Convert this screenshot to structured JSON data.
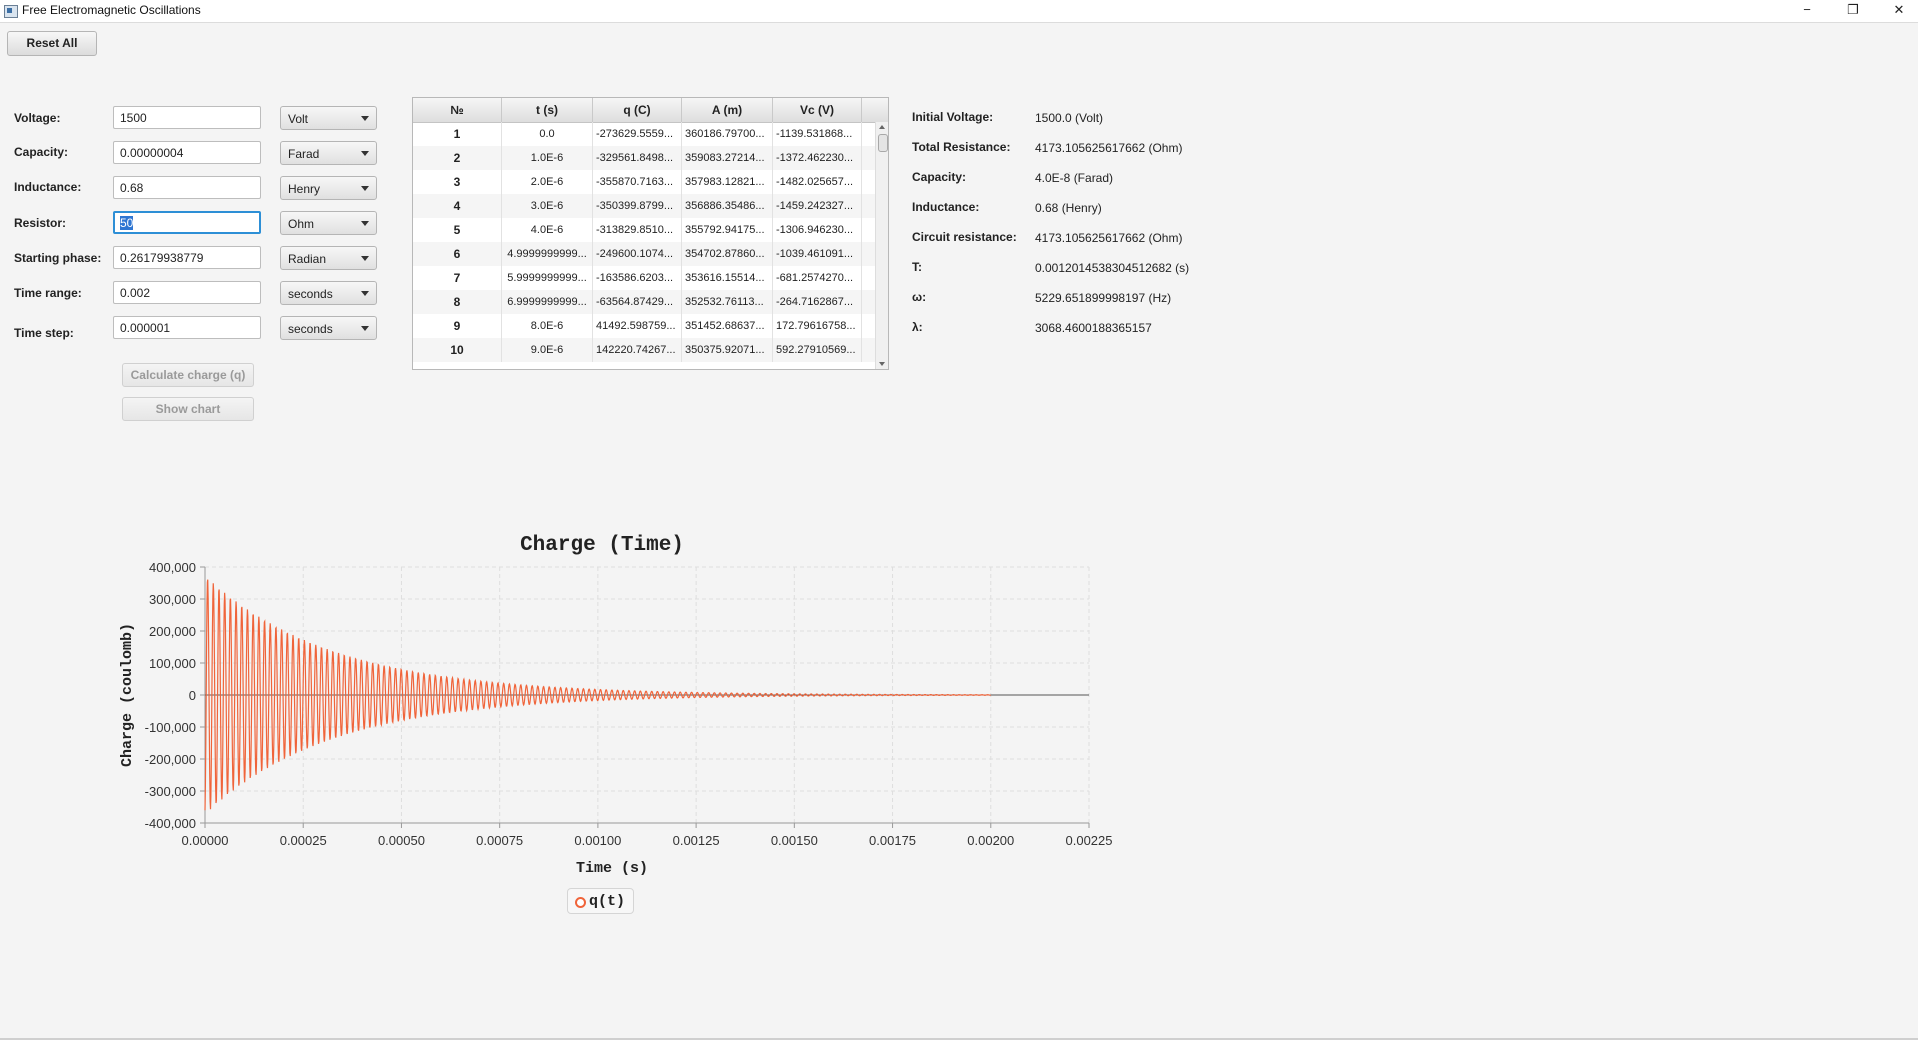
{
  "window": {
    "title": "Free Electromagnetic Oscillations",
    "minimize_glyph": "−",
    "restore_glyph": "❐",
    "close_glyph": "✕"
  },
  "toolbar": {
    "reset_label": "Reset All"
  },
  "form": {
    "voltage": {
      "label": "Voltage:",
      "value": "1500",
      "unit": "Volt"
    },
    "capacity": {
      "label": "Capacity:",
      "value": "0.00000004",
      "unit": "Farad"
    },
    "inductance": {
      "label": "Inductance:",
      "value": "0.68",
      "unit": "Henry"
    },
    "resistor": {
      "label": "Resistor:",
      "value": "50",
      "unit": "Ohm"
    },
    "phase": {
      "label": "Starting phase:",
      "value": "0.26179938779",
      "unit": "Radian"
    },
    "time_range": {
      "label": "Time range:",
      "value": "0.002",
      "unit": "seconds"
    },
    "time_step": {
      "label": "Time step:",
      "value": "0.000001",
      "unit": "seconds"
    },
    "calculate_label": "Calculate charge (q)",
    "show_chart_label": "Show chart"
  },
  "table": {
    "headers": [
      "№",
      "t (s)",
      "q (C)",
      "A (m)",
      "Vc (V)"
    ],
    "rows": [
      [
        "1",
        "0.0",
        "-273629.5559...",
        "360186.79700...",
        "-1139.531868..."
      ],
      [
        "2",
        "1.0E-6",
        "-329561.8498...",
        "359083.27214...",
        "-1372.462230..."
      ],
      [
        "3",
        "2.0E-6",
        "-355870.7163...",
        "357983.12821...",
        "-1482.025657..."
      ],
      [
        "4",
        "3.0E-6",
        "-350399.8799...",
        "356886.35486...",
        "-1459.242327..."
      ],
      [
        "5",
        "4.0E-6",
        "-313829.8510...",
        "355792.94175...",
        "-1306.946230..."
      ],
      [
        "6",
        "4.9999999999...",
        "-249600.1074...",
        "354702.87860...",
        "-1039.461091..."
      ],
      [
        "7",
        "5.9999999999...",
        "-163586.6203...",
        "353616.15514...",
        "-681.2574270..."
      ],
      [
        "8",
        "6.9999999999...",
        "-63564.87429...",
        "352532.76113...",
        "-264.7162867..."
      ],
      [
        "9",
        "8.0E-6",
        "41492.598759...",
        "351452.68637...",
        "172.79616758..."
      ],
      [
        "10",
        "9.0E-6",
        "142220.74267...",
        "350375.92071...",
        "592.27910569..."
      ]
    ]
  },
  "info": [
    {
      "label": "Initial Voltage:",
      "value": "1500.0 (Volt)"
    },
    {
      "label": "Total Resistance:",
      "value": "4173.105625617662 (Ohm)"
    },
    {
      "label": "Capacity:",
      "value": "4.0E-8 (Farad)"
    },
    {
      "label": "Inductance:",
      "value": "0.68 (Henry)"
    },
    {
      "label": "Circuit resistance:",
      "value": "4173.105625617662 (Ohm)"
    },
    {
      "label": "T:",
      "value": "0.0012014538304512682 (s)"
    },
    {
      "label": "ω:",
      "value": "5229.651899998197 (Hz)"
    },
    {
      "label": "λ:",
      "value": "3068.4600188365157"
    }
  ],
  "chart_data": {
    "type": "line",
    "title": "Charge (Time)",
    "xlabel": "Time (s)",
    "ylabel": "Charge (coulomb)",
    "xlim": [
      0,
      0.00225
    ],
    "ylim": [
      -400000,
      400000
    ],
    "x_ticks": [
      "0.00000",
      "0.00025",
      "0.00050",
      "0.00075",
      "0.00100",
      "0.00125",
      "0.00150",
      "0.00175",
      "0.00200",
      "0.00225"
    ],
    "y_ticks": [
      "400,000",
      "300,000",
      "200,000",
      "100,000",
      "0",
      "-100,000",
      "-200,000",
      "-300,000",
      "-400,000"
    ],
    "grid": true,
    "legend_position": "bottom",
    "series": [
      {
        "name": "q(t)",
        "color": "#f0643a",
        "x_start": 0,
        "x_end": 0.002,
        "x_step": 1e-06,
        "amplitude": 373000,
        "damping": 3068.4600188365157,
        "omega": 5229.651899998197,
        "phase": 0.26179938779
      }
    ]
  }
}
